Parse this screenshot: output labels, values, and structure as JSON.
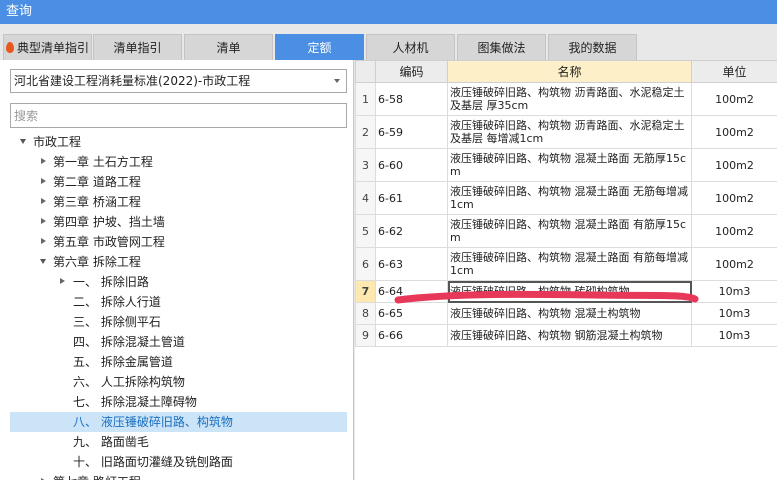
{
  "window": {
    "title": "查询"
  },
  "tabs": [
    {
      "label": "典型清单指引",
      "active": false,
      "icon": "flame-icon"
    },
    {
      "label": "清单指引",
      "active": false
    },
    {
      "label": "清单",
      "active": false
    },
    {
      "label": "定额",
      "active": true
    },
    {
      "label": "人材机",
      "active": false
    },
    {
      "label": "图集做法",
      "active": false
    },
    {
      "label": "我的数据",
      "active": false
    }
  ],
  "left_panel": {
    "standard_select": {
      "value": "河北省建设工程消耗量标准(2022)-市政工程"
    },
    "search": {
      "placeholder": "搜索",
      "value": ""
    },
    "tree": [
      {
        "label": "市政工程",
        "level": 0,
        "state": "expanded"
      },
      {
        "label": "第一章 土石方工程",
        "level": 1,
        "state": "collapsed"
      },
      {
        "label": "第二章 道路工程",
        "level": 1,
        "state": "collapsed"
      },
      {
        "label": "第三章 桥涵工程",
        "level": 1,
        "state": "collapsed"
      },
      {
        "label": "第四章 护坡、挡土墙",
        "level": 1,
        "state": "collapsed"
      },
      {
        "label": "第五章 市政管网工程",
        "level": 1,
        "state": "collapsed"
      },
      {
        "label": "第六章 拆除工程",
        "level": 1,
        "state": "expanded"
      },
      {
        "label": "一、 拆除旧路",
        "level": 2,
        "state": "collapsed"
      },
      {
        "label": "二、 拆除人行道",
        "level": 2,
        "state": "leaf"
      },
      {
        "label": "三、 拆除侧平石",
        "level": 2,
        "state": "leaf"
      },
      {
        "label": "四、 拆除混凝土管道",
        "level": 2,
        "state": "leaf"
      },
      {
        "label": "五、 拆除金属管道",
        "level": 2,
        "state": "leaf"
      },
      {
        "label": "六、 人工拆除构筑物",
        "level": 2,
        "state": "leaf"
      },
      {
        "label": "七、 拆除混凝土障碍物",
        "level": 2,
        "state": "leaf"
      },
      {
        "label": "八、 液压锤破碎旧路、构筑物",
        "level": 2,
        "state": "leaf",
        "selected": true
      },
      {
        "label": "九、 路面凿毛",
        "level": 2,
        "state": "leaf"
      },
      {
        "label": "十、 旧路面切灌缝及铣刨路面",
        "level": 2,
        "state": "leaf"
      },
      {
        "label": "第七章 路灯工程",
        "level": 1,
        "state": "collapsed"
      }
    ]
  },
  "grid": {
    "columns": {
      "code": "编码",
      "name": "名称",
      "unit": "单位"
    },
    "rows": [
      {
        "idx": "1",
        "code": "6-58",
        "name": "液压锤破碎旧路、构筑物 沥青路面、水泥稳定土及基层 厚35cm",
        "unit": "100m2"
      },
      {
        "idx": "2",
        "code": "6-59",
        "name": "液压锤破碎旧路、构筑物 沥青路面、水泥稳定土及基层 每增减1cm",
        "unit": "100m2"
      },
      {
        "idx": "3",
        "code": "6-60",
        "name": "液压锤破碎旧路、构筑物 混凝土路面 无筋厚15cm",
        "unit": "100m2"
      },
      {
        "idx": "4",
        "code": "6-61",
        "name": "液压锤破碎旧路、构筑物 混凝土路面 无筋每增减1cm",
        "unit": "100m2"
      },
      {
        "idx": "5",
        "code": "6-62",
        "name": "液压锤破碎旧路、构筑物 混凝土路面 有筋厚15cm",
        "unit": "100m2"
      },
      {
        "idx": "6",
        "code": "6-63",
        "name": "液压锤破碎旧路、构筑物 混凝土路面 有筋每增减1cm",
        "unit": "100m2"
      },
      {
        "idx": "7",
        "code": "6-64",
        "name": "液压锤破碎旧路、构筑物 砖砌构筑物",
        "unit": "10m3",
        "current": true
      },
      {
        "idx": "8",
        "code": "6-65",
        "name": "液压锤破碎旧路、构筑物 混凝土构筑物",
        "unit": "10m3"
      },
      {
        "idx": "9",
        "code": "6-66",
        "name": "液压锤破碎旧路、构筑物 钢筋混凝土构筑物",
        "unit": "10m3"
      }
    ]
  },
  "colors": {
    "accent": "#4a8fe4",
    "selected_bg": "#cce4f7",
    "redaction": "#e8385a",
    "name_header_bg": "#fdf0c8"
  }
}
